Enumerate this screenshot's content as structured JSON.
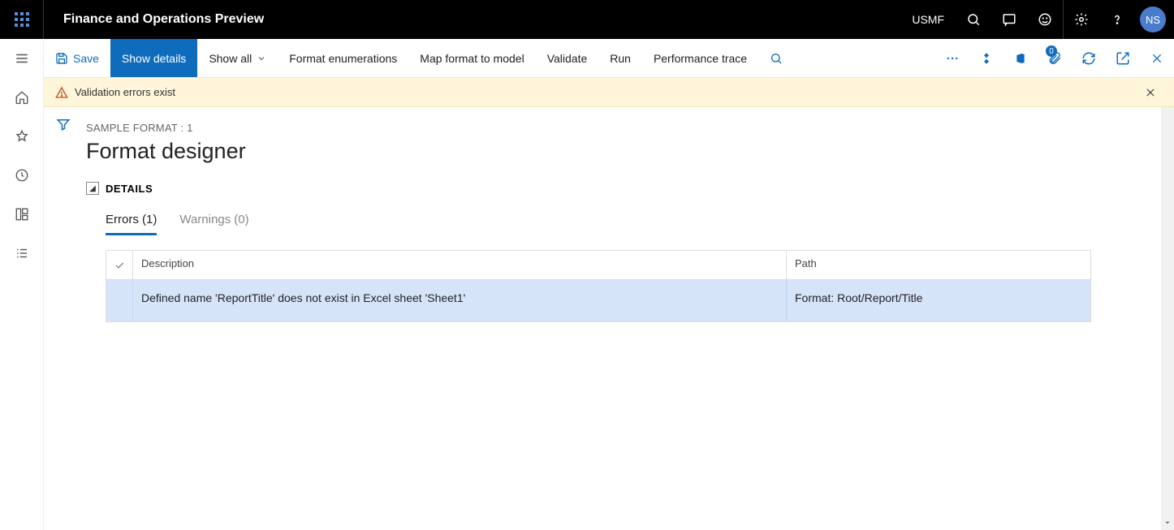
{
  "app": {
    "title": "Finance and Operations Preview",
    "company": "USMF",
    "user_initials": "NS"
  },
  "toolbar": {
    "save": "Save",
    "show_details": "Show details",
    "show_all": "Show all",
    "format_enumerations": "Format enumerations",
    "map_format_to_model": "Map format to model",
    "validate": "Validate",
    "run": "Run",
    "performance_trace": "Performance trace",
    "attachment_badge": "0"
  },
  "notification": {
    "message": "Validation errors exist"
  },
  "page": {
    "breadcrumb": "SAMPLE FORMAT : 1",
    "title": "Format designer",
    "details_section": "DETAILS",
    "tabs": {
      "errors_label": "Errors (1)",
      "warnings_label": "Warnings (0)"
    },
    "grid": {
      "columns": {
        "description": "Description",
        "path": "Path"
      },
      "rows": [
        {
          "description": "Defined name 'ReportTitle' does not exist in Excel sheet 'Sheet1'",
          "path": "Format: Root/Report/Title"
        }
      ]
    }
  }
}
